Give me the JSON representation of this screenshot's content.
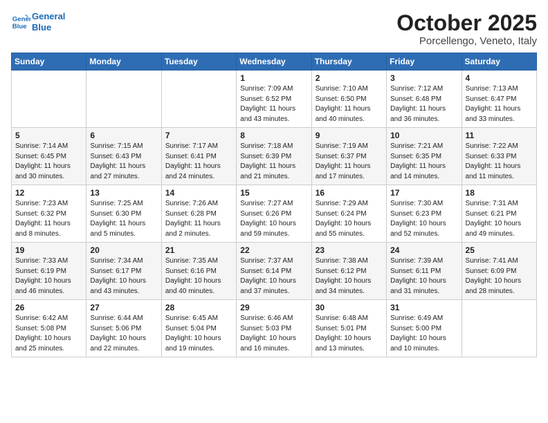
{
  "logo": {
    "line1": "General",
    "line2": "Blue"
  },
  "title": "October 2025",
  "subtitle": "Porcellengo, Veneto, Italy",
  "weekdays": [
    "Sunday",
    "Monday",
    "Tuesday",
    "Wednesday",
    "Thursday",
    "Friday",
    "Saturday"
  ],
  "weeks": [
    [
      {
        "day": "",
        "sunrise": "",
        "sunset": "",
        "daylight": ""
      },
      {
        "day": "",
        "sunrise": "",
        "sunset": "",
        "daylight": ""
      },
      {
        "day": "",
        "sunrise": "",
        "sunset": "",
        "daylight": ""
      },
      {
        "day": "1",
        "sunrise": "Sunrise: 7:09 AM",
        "sunset": "Sunset: 6:52 PM",
        "daylight": "Daylight: 11 hours and 43 minutes."
      },
      {
        "day": "2",
        "sunrise": "Sunrise: 7:10 AM",
        "sunset": "Sunset: 6:50 PM",
        "daylight": "Daylight: 11 hours and 40 minutes."
      },
      {
        "day": "3",
        "sunrise": "Sunrise: 7:12 AM",
        "sunset": "Sunset: 6:48 PM",
        "daylight": "Daylight: 11 hours and 36 minutes."
      },
      {
        "day": "4",
        "sunrise": "Sunrise: 7:13 AM",
        "sunset": "Sunset: 6:47 PM",
        "daylight": "Daylight: 11 hours and 33 minutes."
      }
    ],
    [
      {
        "day": "5",
        "sunrise": "Sunrise: 7:14 AM",
        "sunset": "Sunset: 6:45 PM",
        "daylight": "Daylight: 11 hours and 30 minutes."
      },
      {
        "day": "6",
        "sunrise": "Sunrise: 7:15 AM",
        "sunset": "Sunset: 6:43 PM",
        "daylight": "Daylight: 11 hours and 27 minutes."
      },
      {
        "day": "7",
        "sunrise": "Sunrise: 7:17 AM",
        "sunset": "Sunset: 6:41 PM",
        "daylight": "Daylight: 11 hours and 24 minutes."
      },
      {
        "day": "8",
        "sunrise": "Sunrise: 7:18 AM",
        "sunset": "Sunset: 6:39 PM",
        "daylight": "Daylight: 11 hours and 21 minutes."
      },
      {
        "day": "9",
        "sunrise": "Sunrise: 7:19 AM",
        "sunset": "Sunset: 6:37 PM",
        "daylight": "Daylight: 11 hours and 17 minutes."
      },
      {
        "day": "10",
        "sunrise": "Sunrise: 7:21 AM",
        "sunset": "Sunset: 6:35 PM",
        "daylight": "Daylight: 11 hours and 14 minutes."
      },
      {
        "day": "11",
        "sunrise": "Sunrise: 7:22 AM",
        "sunset": "Sunset: 6:33 PM",
        "daylight": "Daylight: 11 hours and 11 minutes."
      }
    ],
    [
      {
        "day": "12",
        "sunrise": "Sunrise: 7:23 AM",
        "sunset": "Sunset: 6:32 PM",
        "daylight": "Daylight: 11 hours and 8 minutes."
      },
      {
        "day": "13",
        "sunrise": "Sunrise: 7:25 AM",
        "sunset": "Sunset: 6:30 PM",
        "daylight": "Daylight: 11 hours and 5 minutes."
      },
      {
        "day": "14",
        "sunrise": "Sunrise: 7:26 AM",
        "sunset": "Sunset: 6:28 PM",
        "daylight": "Daylight: 11 hours and 2 minutes."
      },
      {
        "day": "15",
        "sunrise": "Sunrise: 7:27 AM",
        "sunset": "Sunset: 6:26 PM",
        "daylight": "Daylight: 10 hours and 59 minutes."
      },
      {
        "day": "16",
        "sunrise": "Sunrise: 7:29 AM",
        "sunset": "Sunset: 6:24 PM",
        "daylight": "Daylight: 10 hours and 55 minutes."
      },
      {
        "day": "17",
        "sunrise": "Sunrise: 7:30 AM",
        "sunset": "Sunset: 6:23 PM",
        "daylight": "Daylight: 10 hours and 52 minutes."
      },
      {
        "day": "18",
        "sunrise": "Sunrise: 7:31 AM",
        "sunset": "Sunset: 6:21 PM",
        "daylight": "Daylight: 10 hours and 49 minutes."
      }
    ],
    [
      {
        "day": "19",
        "sunrise": "Sunrise: 7:33 AM",
        "sunset": "Sunset: 6:19 PM",
        "daylight": "Daylight: 10 hours and 46 minutes."
      },
      {
        "day": "20",
        "sunrise": "Sunrise: 7:34 AM",
        "sunset": "Sunset: 6:17 PM",
        "daylight": "Daylight: 10 hours and 43 minutes."
      },
      {
        "day": "21",
        "sunrise": "Sunrise: 7:35 AM",
        "sunset": "Sunset: 6:16 PM",
        "daylight": "Daylight: 10 hours and 40 minutes."
      },
      {
        "day": "22",
        "sunrise": "Sunrise: 7:37 AM",
        "sunset": "Sunset: 6:14 PM",
        "daylight": "Daylight: 10 hours and 37 minutes."
      },
      {
        "day": "23",
        "sunrise": "Sunrise: 7:38 AM",
        "sunset": "Sunset: 6:12 PM",
        "daylight": "Daylight: 10 hours and 34 minutes."
      },
      {
        "day": "24",
        "sunrise": "Sunrise: 7:39 AM",
        "sunset": "Sunset: 6:11 PM",
        "daylight": "Daylight: 10 hours and 31 minutes."
      },
      {
        "day": "25",
        "sunrise": "Sunrise: 7:41 AM",
        "sunset": "Sunset: 6:09 PM",
        "daylight": "Daylight: 10 hours and 28 minutes."
      }
    ],
    [
      {
        "day": "26",
        "sunrise": "Sunrise: 6:42 AM",
        "sunset": "Sunset: 5:08 PM",
        "daylight": "Daylight: 10 hours and 25 minutes."
      },
      {
        "day": "27",
        "sunrise": "Sunrise: 6:44 AM",
        "sunset": "Sunset: 5:06 PM",
        "daylight": "Daylight: 10 hours and 22 minutes."
      },
      {
        "day": "28",
        "sunrise": "Sunrise: 6:45 AM",
        "sunset": "Sunset: 5:04 PM",
        "daylight": "Daylight: 10 hours and 19 minutes."
      },
      {
        "day": "29",
        "sunrise": "Sunrise: 6:46 AM",
        "sunset": "Sunset: 5:03 PM",
        "daylight": "Daylight: 10 hours and 16 minutes."
      },
      {
        "day": "30",
        "sunrise": "Sunrise: 6:48 AM",
        "sunset": "Sunset: 5:01 PM",
        "daylight": "Daylight: 10 hours and 13 minutes."
      },
      {
        "day": "31",
        "sunrise": "Sunrise: 6:49 AM",
        "sunset": "Sunset: 5:00 PM",
        "daylight": "Daylight: 10 hours and 10 minutes."
      },
      {
        "day": "",
        "sunrise": "",
        "sunset": "",
        "daylight": ""
      }
    ]
  ]
}
